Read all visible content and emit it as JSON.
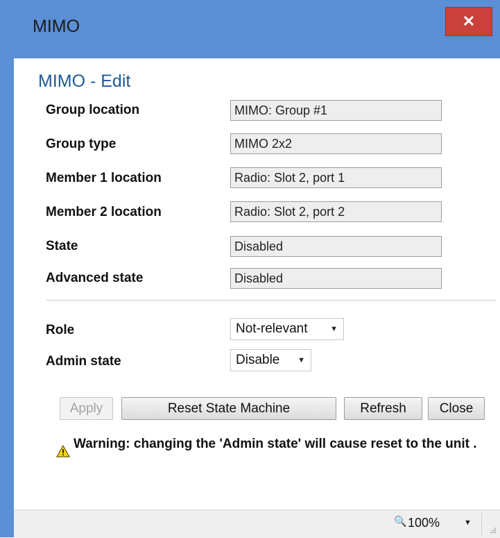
{
  "window": {
    "title": "MIMO",
    "close_glyph": "✕"
  },
  "heading": "MIMO - Edit",
  "fields": [
    {
      "label": "Group location",
      "value": "MIMO: Group #1"
    },
    {
      "label": "Group type",
      "value": "MIMO 2x2"
    },
    {
      "label": "Member 1 location",
      "value": "Radio: Slot 2, port 1"
    },
    {
      "label": "Member 2 location",
      "value": "Radio: Slot 2, port 2"
    },
    {
      "label": "State",
      "value": "Disabled"
    },
    {
      "label": "Advanced state",
      "value": "Disabled"
    }
  ],
  "role": {
    "label": "Role",
    "selected": "Not-relevant"
  },
  "admin_state": {
    "label": "Admin state",
    "selected": "Disable"
  },
  "buttons": {
    "apply": "Apply",
    "reset": "Reset State Machine",
    "refresh": "Refresh",
    "close": "Close"
  },
  "warning": {
    "icon": "warning-triangle-icon",
    "text": "Warning: changing the 'Admin state' will cause reset to the unit ."
  },
  "statusbar": {
    "zoom": "100%",
    "zoom_icon": "zoom-in-icon"
  },
  "colors": {
    "titlebar": "#5a8ed5",
    "close_button": "#c9413a",
    "heading": "#1e5b96"
  }
}
